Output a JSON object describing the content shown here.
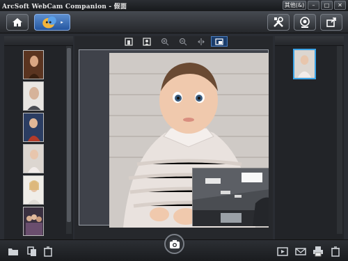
{
  "window": {
    "title": "ArcSoft WebCam Companion - 假面",
    "other_label": "其他(&)",
    "minimize_label": "–",
    "maximize_label": "□",
    "close_label": "✕"
  },
  "toolbar": {
    "home": "home-icon",
    "mode": "mask-mode-icon",
    "tools": "tools-icon",
    "webcam": "webcam-icon",
    "export": "export-icon"
  },
  "photo_tools": [
    "frame-icon",
    "face-icon",
    "zoom-in-icon",
    "zoom-out-icon",
    "mirror-icon",
    "pip-icon"
  ],
  "left_thumbnails": [
    {
      "name": "thumb-portrait-woman",
      "color": "#7a4a2a"
    },
    {
      "name": "thumb-man",
      "color": "#a0958c"
    },
    {
      "name": "thumb-child-red",
      "color": "#2a4470"
    },
    {
      "name": "thumb-baby",
      "color": "#d8cfc8"
    },
    {
      "name": "thumb-blonde-woman",
      "color": "#cfc2b0"
    },
    {
      "name": "thumb-group",
      "color": "#4a3c48"
    }
  ],
  "bottom_left": [
    "folder-icon",
    "copy-icon",
    "trash-icon"
  ],
  "bottom_right": [
    "slideshow-icon",
    "email-icon",
    "print-icon",
    "delete-icon"
  ],
  "colors": {
    "accent": "#3aa4e8",
    "panel": "#222428",
    "canvas": "#3f424a"
  }
}
